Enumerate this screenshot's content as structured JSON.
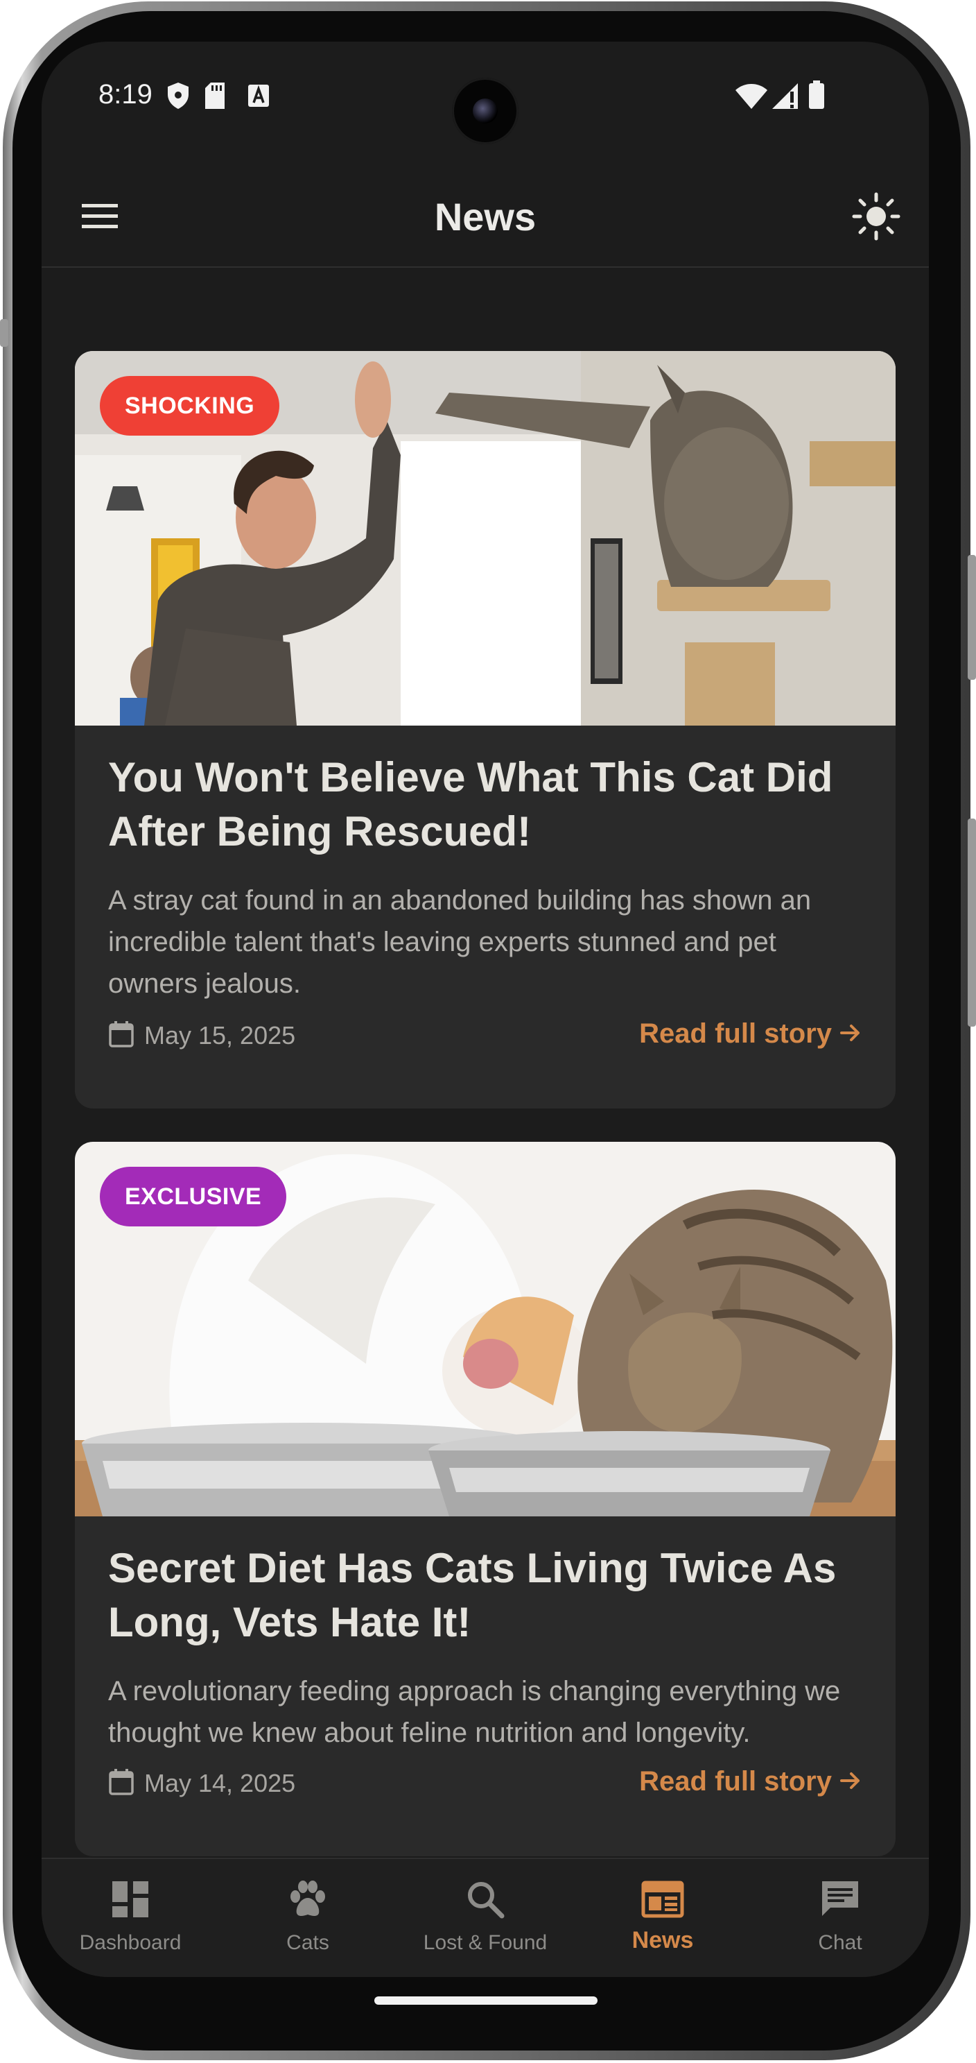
{
  "status_bar": {
    "time": "8:19",
    "icons": [
      "shield-icon",
      "sd-card-icon",
      "font-download-icon",
      "wifi-icon",
      "cellular-signal-icon",
      "battery-icon"
    ]
  },
  "app_bar": {
    "title": "News",
    "left_icon": "menu-icon",
    "right_icon": "sun-icon"
  },
  "articles": [
    {
      "tag": "SHOCKING",
      "tag_color": "#ef4035",
      "image": "man-high-fiving-cat-photo",
      "title": "You Won't Believe What This Cat Did After Being Rescued!",
      "summary": "A stray cat found in an abandoned building has shown an incredible talent that's leaving experts stunned and pet owners jealous.",
      "date": "May 15, 2025",
      "read_more": "Read full story"
    },
    {
      "tag": "EXCLUSIVE",
      "tag_color": "#a32bb8",
      "image": "cats-eating-from-bowls-photo",
      "title": "Secret Diet Has Cats Living Twice As Long, Vets Hate It!",
      "summary": "A revolutionary feeding approach is changing everything we thought we knew about feline nutrition and longevity.",
      "date": "May 14, 2025",
      "read_more": "Read full story"
    }
  ],
  "bottom_nav": {
    "items": [
      {
        "label": "Dashboard",
        "icon": "dashboard-icon"
      },
      {
        "label": "Cats",
        "icon": "paw-icon"
      },
      {
        "label": "Lost & Found",
        "icon": "search-icon"
      },
      {
        "label": "News",
        "icon": "newspaper-icon"
      },
      {
        "label": "Chat",
        "icon": "chat-icon"
      }
    ],
    "active": "News"
  },
  "colors": {
    "accent": "#d5894a",
    "background": "#1c1c1c",
    "card": "#2a2a2a"
  }
}
